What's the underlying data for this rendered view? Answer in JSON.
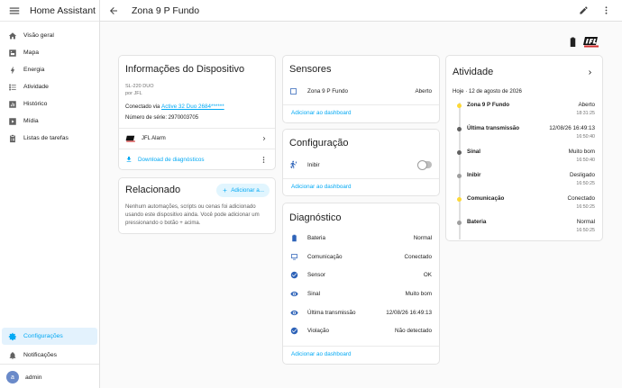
{
  "sidebar": {
    "title": "Home Assistant",
    "items": [
      {
        "label": "Visão geral",
        "icon": "view-dashboard-icon"
      },
      {
        "label": "Mapa",
        "icon": "map-icon"
      },
      {
        "label": "Energia",
        "icon": "lightning-icon"
      },
      {
        "label": "Atividade",
        "icon": "format-list-icon"
      },
      {
        "label": "Histórico",
        "icon": "chart-box-icon"
      },
      {
        "label": "Mídia",
        "icon": "play-box-icon"
      },
      {
        "label": "Listas de tarefas",
        "icon": "clipboard-list-icon"
      }
    ],
    "settings_label": "Configurações",
    "notifications_label": "Notificações",
    "user": {
      "initial": "a",
      "name": "admin"
    }
  },
  "header": {
    "title": "Zona 9 P Fundo"
  },
  "device_info": {
    "title": "Informações do Dispositivo",
    "model": "SL-220 DUO",
    "manufacturer": "por JFL",
    "connected_prefix": "Conectado via ",
    "connected_link": "Active 32 Duo 2684******",
    "serial": "Número de série: 2970003705",
    "integration": "JFL Alarm",
    "download_label": "Download de diagnósticos"
  },
  "related": {
    "title": "Relacionado",
    "add_label": "Adicionar a...",
    "text": "Nenhum automações, scripts ou cenas foi adicionado usando este dispositivo ainda. Você pode adicionar um pressionando o botão + acima."
  },
  "sensors": {
    "title": "Sensores",
    "rows": [
      {
        "name": "Zona 9 P Fundo",
        "value": "Aberto"
      }
    ],
    "add_dashboard": "Adicionar ao dashboard"
  },
  "config": {
    "title": "Configuração",
    "rows": [
      {
        "name": "Inibir",
        "on": false
      }
    ],
    "add_dashboard": "Adicionar ao dashboard"
  },
  "diagnostic": {
    "title": "Diagnóstico",
    "rows": [
      {
        "name": "Bateria",
        "value": "Normal",
        "icon": "battery-icon"
      },
      {
        "name": "Comunicação",
        "value": "Conectado",
        "icon": "monitor-icon"
      },
      {
        "name": "Sensor",
        "value": "OK",
        "icon": "check-circle-icon"
      },
      {
        "name": "Sinal",
        "value": "Muito bom",
        "icon": "eye-icon"
      },
      {
        "name": "Última transmissão",
        "value": "12/08/26 16:49:13",
        "icon": "eye-icon"
      },
      {
        "name": "Violação",
        "value": "Não detectado",
        "icon": "check-circle-icon"
      }
    ],
    "add_dashboard": "Adicionar ao dashboard"
  },
  "activity": {
    "title": "Atividade",
    "date": "Hoje · 12 de agosto de 2026",
    "events": [
      {
        "name": "Zona 9 P Fundo",
        "state": "Aberto",
        "time": "18:31:25",
        "color": "#fdd835"
      },
      {
        "name": "Última transmissão",
        "state": "12/08/26 16:49:13",
        "time": "16:50:40",
        "color": "#616161"
      },
      {
        "name": "Sinal",
        "state": "Muito bom",
        "time": "16:50:40",
        "color": "#616161"
      },
      {
        "name": "Inibir",
        "state": "Desligado",
        "time": "16:50:25",
        "color": "#9e9e9e"
      },
      {
        "name": "Comunicação",
        "state": "Conectado",
        "time": "16:50:25",
        "color": "#fdd835"
      },
      {
        "name": "Bateria",
        "state": "Normal",
        "time": "16:50:25",
        "color": "#9e9e9e"
      }
    ]
  },
  "colors": {
    "accent": "#03a9f4",
    "icon_blue": "#2e63b8"
  }
}
